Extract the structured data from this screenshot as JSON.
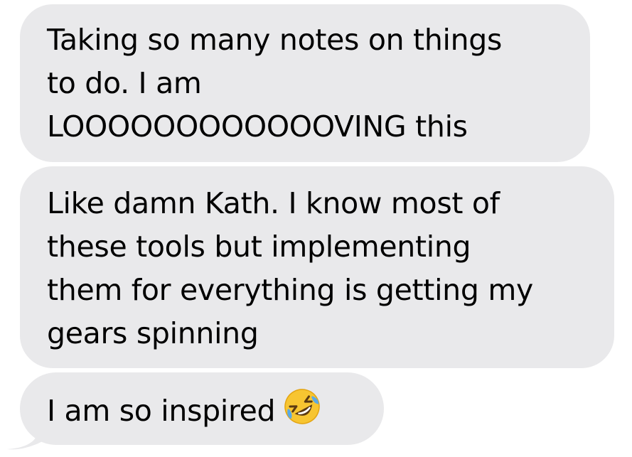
{
  "messages": [
    {
      "lines": [
        "Taking so many notes on things",
        "to do. I am",
        "LOOOOOOOOOOOOVING this"
      ]
    },
    {
      "lines": [
        "Like damn Kath. I know most of",
        "these tools but implementing",
        "them for everything is getting my",
        "gears spinning"
      ]
    },
    {
      "lines": [
        "I am so inspired"
      ],
      "emoji": "rolling-on-floor-laughing-icon"
    }
  ],
  "colors": {
    "bubble_background": "#e9e9eb",
    "text": "#000000",
    "emoji_face": "#f7c531",
    "emoji_tears": "#5aa9e6"
  }
}
